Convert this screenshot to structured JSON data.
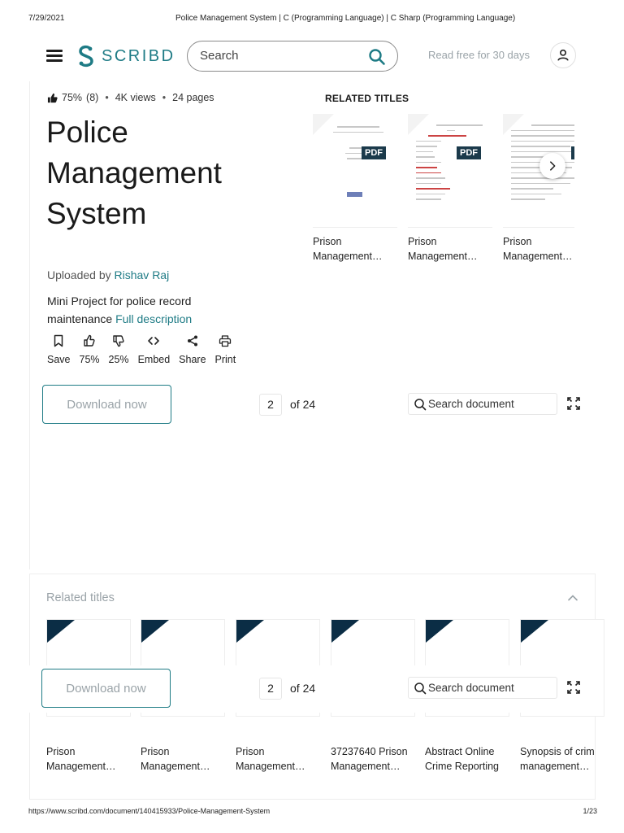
{
  "print_header": {
    "date": "7/29/2021",
    "title": "Police Management System | C (Programming Language) | C Sharp (Programming Language)"
  },
  "print_footer": {
    "url": "https://www.scribd.com/document/140415933/Police-Management-System",
    "page": "1/23"
  },
  "nav": {
    "logo_text": "SCRIBD",
    "search_placeholder": "Search",
    "read_free": "Read free for 30 days"
  },
  "doc": {
    "rating_percent": "75%",
    "rating_count": "(8)",
    "views": "4K views",
    "pages": "24 pages",
    "title_lines": [
      "Police",
      "Management",
      "System"
    ],
    "uploaded_by_label": "Uploaded by",
    "author": "Rishav Raj",
    "description": "Mini Project for police record maintenance",
    "full_description_link": "Full description"
  },
  "actions": [
    {
      "label": "Save",
      "icon": "bookmark-icon"
    },
    {
      "label": "75%",
      "icon": "thumbs-up-icon"
    },
    {
      "label": "25%",
      "icon": "thumbs-down-icon"
    },
    {
      "label": "Embed",
      "icon": "code-icon"
    },
    {
      "label": "Share",
      "icon": "share-icon"
    },
    {
      "label": "Print",
      "icon": "printer-icon"
    }
  ],
  "related_top": {
    "heading": "RELATED TITLES",
    "badge": "PDF",
    "items": [
      {
        "label_lines": [
          "Prison",
          "Management…"
        ]
      },
      {
        "label_lines": [
          "Prison",
          "Management…"
        ]
      },
      {
        "label_lines": [
          "Prison",
          "Management…"
        ]
      }
    ]
  },
  "toolbar": {
    "download_label": "Download now",
    "page_value": "2",
    "page_of": "of 24",
    "search_placeholder": "Search document"
  },
  "related_bottom": {
    "heading": "Related titles",
    "items": [
      {
        "label_lines": [
          "Prison",
          "Management…"
        ]
      },
      {
        "label_lines": [
          "Prison",
          "Management…"
        ]
      },
      {
        "label_lines": [
          "Prison",
          "Management…"
        ]
      },
      {
        "label_lines": [
          "37237640 Prison",
          "Management…"
        ]
      },
      {
        "label_lines": [
          "Abstract Online",
          "Crime Reporting"
        ]
      },
      {
        "label_lines": [
          "Synopsis of crime",
          "management…"
        ]
      }
    ]
  },
  "colors": {
    "accent": "#1e7b85",
    "dark_navy": "#0b2d45",
    "muted": "#9aa3a8"
  }
}
